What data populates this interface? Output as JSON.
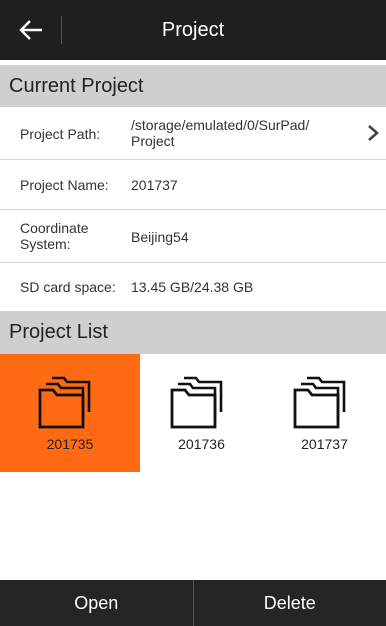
{
  "header": {
    "title": "Project",
    "back_icon": "back-arrow-icon"
  },
  "current_project": {
    "title": "Current Project",
    "rows": [
      {
        "label": "Project Path:",
        "value": "/storage/emulated/0/SurPad/\nProject"
      },
      {
        "label": "Project Name:",
        "value": "201737"
      },
      {
        "label": "Coordinate\nSystem:",
        "value": "Beijing54"
      },
      {
        "label": "SD card space:",
        "value": "13.45 GB/24.38 GB"
      }
    ]
  },
  "project_list": {
    "title": "Project List",
    "items": [
      {
        "name": "201735",
        "selected": true
      },
      {
        "name": "201736",
        "selected": false
      },
      {
        "name": "201737",
        "selected": false
      }
    ],
    "selected_color": "#ff6a13"
  },
  "actions": {
    "open_label": "Open",
    "delete_label": "Delete"
  }
}
